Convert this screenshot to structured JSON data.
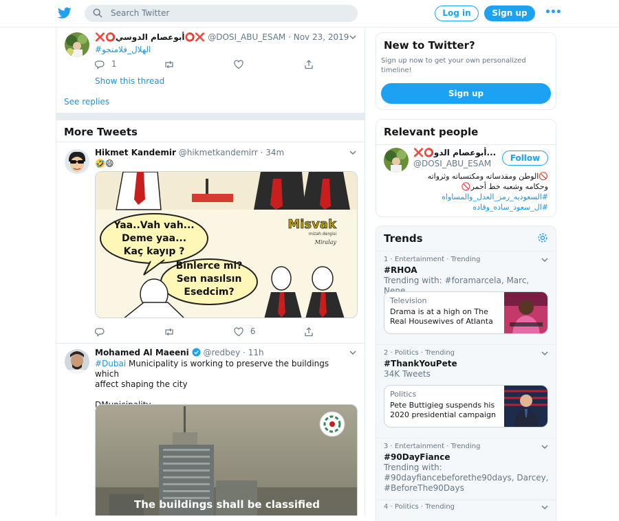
{
  "header": {
    "search_placeholder": "Search Twitter",
    "login_label": "Log in",
    "signup_label": "Sign up"
  },
  "first_tweet": {
    "name": "❌⭕أبوعصام الدوسي⭕❌",
    "handle": "@DOSI_ABU_ESAM",
    "date": "Nov 23, 2019",
    "text": "#الهلال_فلامنجو",
    "reply_count": "1",
    "show_thread": "Show this thread",
    "see_replies": "See replies"
  },
  "more_tweets_header": "More Tweets",
  "tweets": [
    {
      "name": "Hikmet Kandemir",
      "handle": "@hikmetkandemirr",
      "time": "· 34m",
      "text": "🤣😄",
      "like_count": "6",
      "cartoon": {
        "bubble1": [
          "Yaa..Vah vah...",
          "Deme yaa...",
          "Kaç kayıp ?"
        ],
        "bubble2": [
          "Binlerce mi?",
          "Sen nasılsın",
          "Esedcim?"
        ],
        "brand": "Misvak",
        "brand_sub": "mizah dergisi",
        "signature": "Miralay"
      }
    },
    {
      "name": "Mohamed Al Maeeni",
      "handle": "@redbey",
      "time": "· 11h",
      "hashtag": "#Dubai",
      "text_line1": " Municipality is working to preserve the buildings which",
      "text_line2": "affect shaping the city",
      "text_line3": "DMunicipality",
      "video_caption": "The buildings shall be classified"
    }
  ],
  "signup_card": {
    "title": "New to Twitter?",
    "desc": "Sign up now to get your own personalized timeline!",
    "button": "Sign up"
  },
  "relevant_people": {
    "title": "Relevant people",
    "name": "❌⭕أبوعصام الدو...",
    "handle": "@DOSI_ABU_ESAM",
    "follow": "Follow",
    "bio_line1": "🚫الوطن ومقدساته ومكتسباته وثرواته",
    "bio_line2": "وحكامه وشعبه خط أحمر🚫",
    "bio_tag1": "#السعوديه_رمز_العدل_والمساواه",
    "bio_tag2": "#ال_سعود_ساده_وقاده"
  },
  "trends": {
    "title": "Trends",
    "items": [
      {
        "meta": "1 · Entertainment · Trending",
        "name": "#RHOA",
        "sub": "Trending with: #foramarcela, Marc, Nene",
        "card": {
          "category": "Television",
          "headline": "Drama is at a high on The Real Housewives of Atlanta"
        }
      },
      {
        "meta": "2 · Politics · Trending",
        "name": "#ThankYouPete",
        "sub": "34K Tweets",
        "card": {
          "category": "Politics",
          "headline": "Pete Buttigieg suspends his 2020 presidential campaign"
        }
      },
      {
        "meta": "3 · Entertainment · Trending",
        "name": "#90DayFiance",
        "sub": "Trending with: #90dayfiancebeforethe90days, Darcey, #BeforeThe90Days"
      },
      {
        "meta": "4 · Politics · Trending",
        "name": ""
      }
    ]
  },
  "colors": {
    "accent": "#1da1f2",
    "link": "#1b95e0",
    "muted": "#657786",
    "border": "#e6ecf0"
  }
}
